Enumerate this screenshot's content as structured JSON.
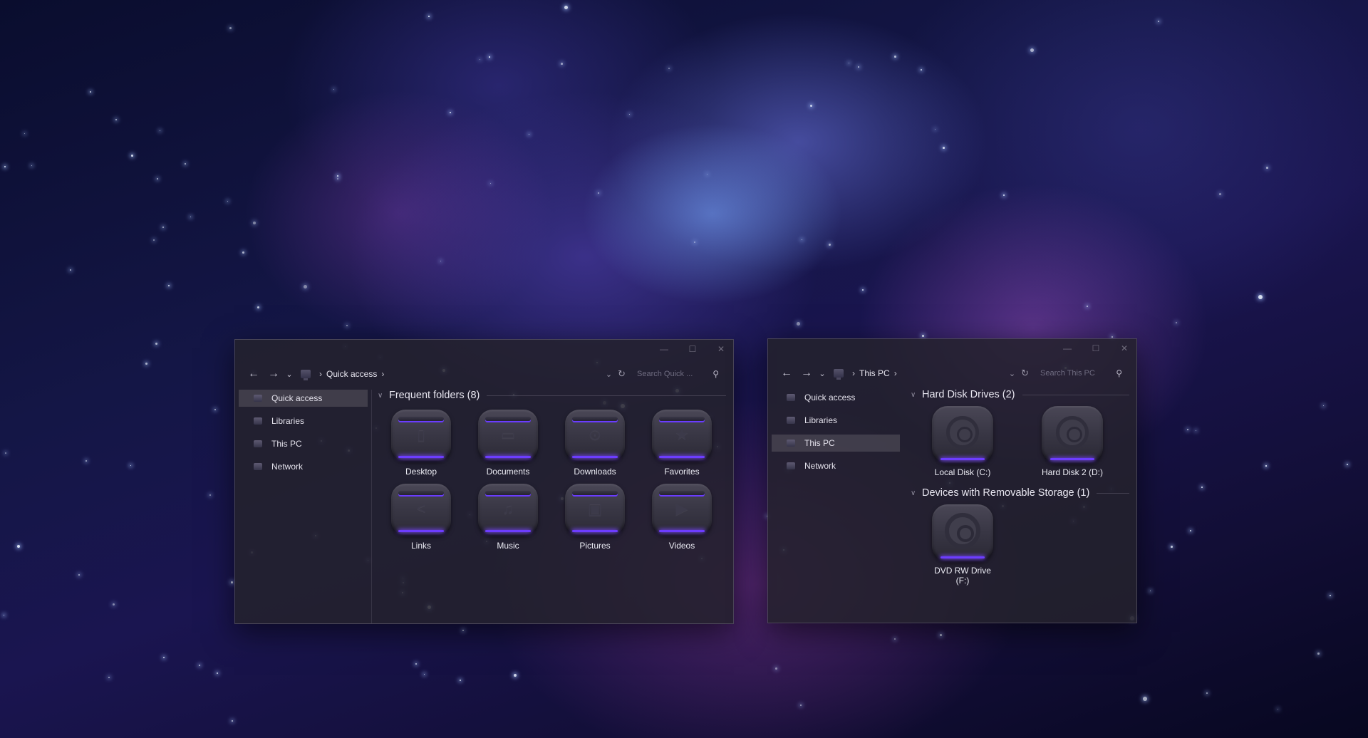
{
  "left_window": {
    "caption": {
      "minimize": "—",
      "maximize": "☐",
      "close": "✕"
    },
    "nav": {
      "back": "←",
      "forward": "→",
      "recent": "⌄"
    },
    "breadcrumb": [
      "Quick access"
    ],
    "search": {
      "placeholder": "Search Quick ..."
    },
    "sidebar": [
      {
        "label": "Quick access",
        "active": true
      },
      {
        "label": "Libraries",
        "active": false
      },
      {
        "label": "This PC",
        "active": false
      },
      {
        "label": "Network",
        "active": false
      }
    ],
    "group_title": "Frequent folders (8)",
    "folders": [
      {
        "label": "Desktop",
        "icon": "desktop-folder-icon",
        "glyph": "▯"
      },
      {
        "label": "Documents",
        "icon": "documents-folder-icon",
        "glyph": "▭"
      },
      {
        "label": "Downloads",
        "icon": "downloads-folder-icon",
        "glyph": "⊙"
      },
      {
        "label": "Favorites",
        "icon": "favorites-folder-icon",
        "glyph": "★"
      },
      {
        "label": "Links",
        "icon": "links-folder-icon",
        "glyph": "<"
      },
      {
        "label": "Music",
        "icon": "music-folder-icon",
        "glyph": "♫"
      },
      {
        "label": "Pictures",
        "icon": "pictures-folder-icon",
        "glyph": "▣"
      },
      {
        "label": "Videos",
        "icon": "videos-folder-icon",
        "glyph": "▶"
      }
    ]
  },
  "right_window": {
    "caption": {
      "minimize": "—",
      "maximize": "☐",
      "close": "✕"
    },
    "nav": {
      "back": "←",
      "forward": "→",
      "recent": "⌄"
    },
    "breadcrumb": [
      "This PC"
    ],
    "search": {
      "placeholder": "Search This PC"
    },
    "sidebar": [
      {
        "label": "Quick access",
        "active": false
      },
      {
        "label": "Libraries",
        "active": false
      },
      {
        "label": "This PC",
        "active": true
      },
      {
        "label": "Network",
        "active": false
      }
    ],
    "hdd_group_title": "Hard Disk Drives (2)",
    "drives": [
      {
        "label": "Local Disk (C:)"
      },
      {
        "label": "Hard Disk 2 (D:)"
      }
    ],
    "removable_group_title": "Devices with Removable Storage (1)",
    "removable": [
      {
        "label": "DVD RW Drive (F:)"
      }
    ]
  },
  "colors": {
    "accent": "#6d3dff",
    "window_bg": "#24222c",
    "text": "#e6e6ee"
  },
  "symbols": {
    "chevron": "›",
    "group_chevron": "∨",
    "dropdown": "⌄",
    "refresh": "↻",
    "search": "⚲"
  }
}
